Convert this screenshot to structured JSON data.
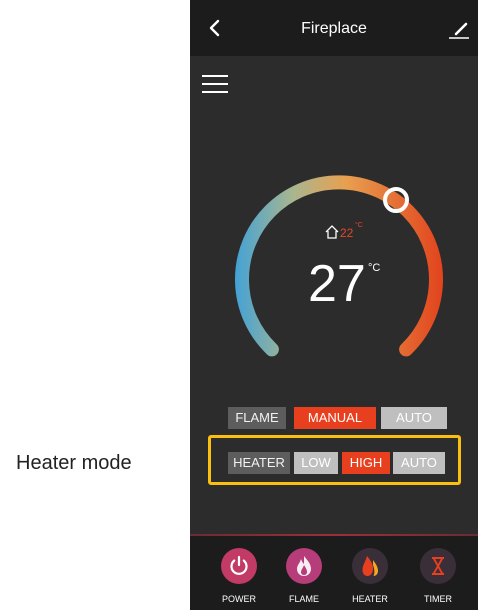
{
  "header": {
    "title": "Fireplace"
  },
  "thermostat": {
    "set_temperature": "27",
    "unit": "°C",
    "room_temperature": "22",
    "room_unit": "°C"
  },
  "flame_mode": {
    "label": "FLAME",
    "options": [
      "MANUAL",
      "AUTO"
    ],
    "selected": "MANUAL"
  },
  "heater_mode": {
    "label": "HEATER",
    "options": [
      "LOW",
      "HIGH",
      "AUTO"
    ],
    "selected": "HIGH"
  },
  "annotation": {
    "text": "Heater mode",
    "highlight_color": "#fbbf10"
  },
  "bottom_nav": [
    {
      "label": "POWER",
      "icon": "power-icon",
      "color": "#c23a66"
    },
    {
      "label": "FLAME",
      "icon": "flame-icon",
      "color": "#b63c7a"
    },
    {
      "label": "HEATER",
      "icon": "heater-icon",
      "color": "#3a2f39"
    },
    {
      "label": "TIMER",
      "icon": "hourglass-icon",
      "color": "#3a2f39"
    }
  ],
  "colors": {
    "accent": "#e8401e",
    "gauge_start": "#3aa0dc",
    "gauge_mid": "#e8a050",
    "gauge_end": "#e2461e",
    "background": "#2c2c2c"
  }
}
